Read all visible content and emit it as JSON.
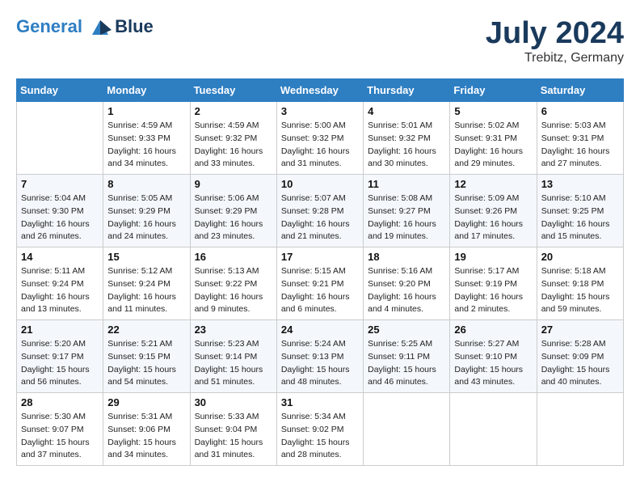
{
  "header": {
    "logo_line1": "General",
    "logo_line2": "Blue",
    "month_year": "July 2024",
    "location": "Trebitz, Germany"
  },
  "weekdays": [
    "Sunday",
    "Monday",
    "Tuesday",
    "Wednesday",
    "Thursday",
    "Friday",
    "Saturday"
  ],
  "weeks": [
    [
      {
        "day": "",
        "sunrise": "",
        "sunset": "",
        "daylight": ""
      },
      {
        "day": "1",
        "sunrise": "Sunrise: 4:59 AM",
        "sunset": "Sunset: 9:33 PM",
        "daylight": "Daylight: 16 hours and 34 minutes."
      },
      {
        "day": "2",
        "sunrise": "Sunrise: 4:59 AM",
        "sunset": "Sunset: 9:32 PM",
        "daylight": "Daylight: 16 hours and 33 minutes."
      },
      {
        "day": "3",
        "sunrise": "Sunrise: 5:00 AM",
        "sunset": "Sunset: 9:32 PM",
        "daylight": "Daylight: 16 hours and 31 minutes."
      },
      {
        "day": "4",
        "sunrise": "Sunrise: 5:01 AM",
        "sunset": "Sunset: 9:32 PM",
        "daylight": "Daylight: 16 hours and 30 minutes."
      },
      {
        "day": "5",
        "sunrise": "Sunrise: 5:02 AM",
        "sunset": "Sunset: 9:31 PM",
        "daylight": "Daylight: 16 hours and 29 minutes."
      },
      {
        "day": "6",
        "sunrise": "Sunrise: 5:03 AM",
        "sunset": "Sunset: 9:31 PM",
        "daylight": "Daylight: 16 hours and 27 minutes."
      }
    ],
    [
      {
        "day": "7",
        "sunrise": "Sunrise: 5:04 AM",
        "sunset": "Sunset: 9:30 PM",
        "daylight": "Daylight: 16 hours and 26 minutes."
      },
      {
        "day": "8",
        "sunrise": "Sunrise: 5:05 AM",
        "sunset": "Sunset: 9:29 PM",
        "daylight": "Daylight: 16 hours and 24 minutes."
      },
      {
        "day": "9",
        "sunrise": "Sunrise: 5:06 AM",
        "sunset": "Sunset: 9:29 PM",
        "daylight": "Daylight: 16 hours and 23 minutes."
      },
      {
        "day": "10",
        "sunrise": "Sunrise: 5:07 AM",
        "sunset": "Sunset: 9:28 PM",
        "daylight": "Daylight: 16 hours and 21 minutes."
      },
      {
        "day": "11",
        "sunrise": "Sunrise: 5:08 AM",
        "sunset": "Sunset: 9:27 PM",
        "daylight": "Daylight: 16 hours and 19 minutes."
      },
      {
        "day": "12",
        "sunrise": "Sunrise: 5:09 AM",
        "sunset": "Sunset: 9:26 PM",
        "daylight": "Daylight: 16 hours and 17 minutes."
      },
      {
        "day": "13",
        "sunrise": "Sunrise: 5:10 AM",
        "sunset": "Sunset: 9:25 PM",
        "daylight": "Daylight: 16 hours and 15 minutes."
      }
    ],
    [
      {
        "day": "14",
        "sunrise": "Sunrise: 5:11 AM",
        "sunset": "Sunset: 9:24 PM",
        "daylight": "Daylight: 16 hours and 13 minutes."
      },
      {
        "day": "15",
        "sunrise": "Sunrise: 5:12 AM",
        "sunset": "Sunset: 9:24 PM",
        "daylight": "Daylight: 16 hours and 11 minutes."
      },
      {
        "day": "16",
        "sunrise": "Sunrise: 5:13 AM",
        "sunset": "Sunset: 9:22 PM",
        "daylight": "Daylight: 16 hours and 9 minutes."
      },
      {
        "day": "17",
        "sunrise": "Sunrise: 5:15 AM",
        "sunset": "Sunset: 9:21 PM",
        "daylight": "Daylight: 16 hours and 6 minutes."
      },
      {
        "day": "18",
        "sunrise": "Sunrise: 5:16 AM",
        "sunset": "Sunset: 9:20 PM",
        "daylight": "Daylight: 16 hours and 4 minutes."
      },
      {
        "day": "19",
        "sunrise": "Sunrise: 5:17 AM",
        "sunset": "Sunset: 9:19 PM",
        "daylight": "Daylight: 16 hours and 2 minutes."
      },
      {
        "day": "20",
        "sunrise": "Sunrise: 5:18 AM",
        "sunset": "Sunset: 9:18 PM",
        "daylight": "Daylight: 15 hours and 59 minutes."
      }
    ],
    [
      {
        "day": "21",
        "sunrise": "Sunrise: 5:20 AM",
        "sunset": "Sunset: 9:17 PM",
        "daylight": "Daylight: 15 hours and 56 minutes."
      },
      {
        "day": "22",
        "sunrise": "Sunrise: 5:21 AM",
        "sunset": "Sunset: 9:15 PM",
        "daylight": "Daylight: 15 hours and 54 minutes."
      },
      {
        "day": "23",
        "sunrise": "Sunrise: 5:23 AM",
        "sunset": "Sunset: 9:14 PM",
        "daylight": "Daylight: 15 hours and 51 minutes."
      },
      {
        "day": "24",
        "sunrise": "Sunrise: 5:24 AM",
        "sunset": "Sunset: 9:13 PM",
        "daylight": "Daylight: 15 hours and 48 minutes."
      },
      {
        "day": "25",
        "sunrise": "Sunrise: 5:25 AM",
        "sunset": "Sunset: 9:11 PM",
        "daylight": "Daylight: 15 hours and 46 minutes."
      },
      {
        "day": "26",
        "sunrise": "Sunrise: 5:27 AM",
        "sunset": "Sunset: 9:10 PM",
        "daylight": "Daylight: 15 hours and 43 minutes."
      },
      {
        "day": "27",
        "sunrise": "Sunrise: 5:28 AM",
        "sunset": "Sunset: 9:09 PM",
        "daylight": "Daylight: 15 hours and 40 minutes."
      }
    ],
    [
      {
        "day": "28",
        "sunrise": "Sunrise: 5:30 AM",
        "sunset": "Sunset: 9:07 PM",
        "daylight": "Daylight: 15 hours and 37 minutes."
      },
      {
        "day": "29",
        "sunrise": "Sunrise: 5:31 AM",
        "sunset": "Sunset: 9:06 PM",
        "daylight": "Daylight: 15 hours and 34 minutes."
      },
      {
        "day": "30",
        "sunrise": "Sunrise: 5:33 AM",
        "sunset": "Sunset: 9:04 PM",
        "daylight": "Daylight: 15 hours and 31 minutes."
      },
      {
        "day": "31",
        "sunrise": "Sunrise: 5:34 AM",
        "sunset": "Sunset: 9:02 PM",
        "daylight": "Daylight: 15 hours and 28 minutes."
      },
      {
        "day": "",
        "sunrise": "",
        "sunset": "",
        "daylight": ""
      },
      {
        "day": "",
        "sunrise": "",
        "sunset": "",
        "daylight": ""
      },
      {
        "day": "",
        "sunrise": "",
        "sunset": "",
        "daylight": ""
      }
    ]
  ]
}
